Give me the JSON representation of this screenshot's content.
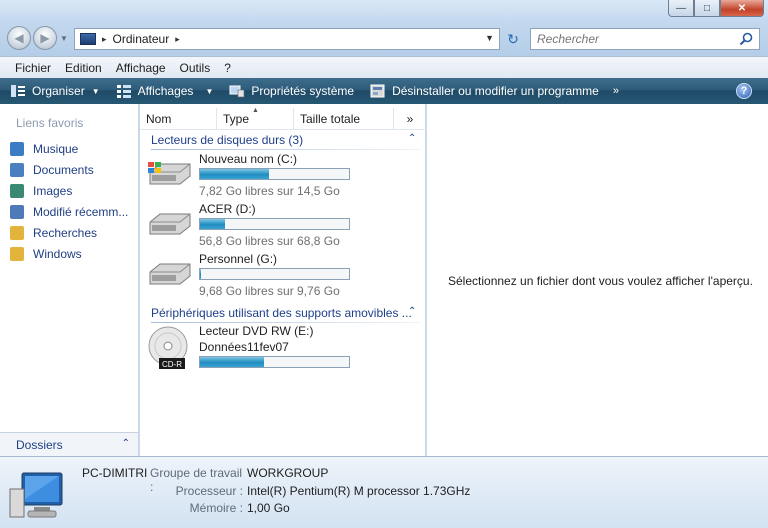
{
  "window": {
    "controls": {
      "minimize": "—",
      "maximize": "□",
      "close": "✕"
    }
  },
  "address_bar": {
    "location": "Ordinateur",
    "separator": "▸"
  },
  "search": {
    "placeholder": "Rechercher"
  },
  "menu": [
    "Fichier",
    "Edition",
    "Affichage",
    "Outils",
    "?"
  ],
  "command_bar": {
    "organize": "Organiser",
    "views": "Affichages",
    "system_properties": "Propriétés système",
    "uninstall": "Désinstaller ou modifier un programme",
    "more": "»",
    "help": "?"
  },
  "nav_pane": {
    "title": "Liens favoris",
    "items": [
      {
        "label": "Musique",
        "icon": "music-icon",
        "color": "#3c7cc5"
      },
      {
        "label": "Documents",
        "icon": "documents-icon",
        "color": "#4a7fc0"
      },
      {
        "label": "Images",
        "icon": "images-icon",
        "color": "#3a8a73"
      },
      {
        "label": "Modifié récemm...",
        "icon": "recent-icon",
        "color": "#4f7ab8"
      },
      {
        "label": "Recherches",
        "icon": "search-folder-icon",
        "color": "#e3b43c"
      },
      {
        "label": "Windows",
        "icon": "folder-icon",
        "color": "#e3b43c"
      }
    ],
    "folders_label": "Dossiers",
    "folders_chevron": "⌃"
  },
  "file_list": {
    "columns": [
      "Nom",
      "Type",
      "Taille totale"
    ],
    "more_columns": "»",
    "groups": [
      {
        "title": "Lecteurs de disques durs (3)",
        "chevron": "⌃"
      },
      {
        "title": "Périphériques utilisant des supports amovibles ...",
        "chevron": "⌃"
      }
    ],
    "drives": [
      {
        "name": "Nouveau nom (C:)",
        "free": "7,82 Go libres sur 14,5 Go",
        "used_fraction": 0.46,
        "icon": "system-drive-icon"
      },
      {
        "name": "ACER (D:)",
        "free": "56,8 Go libres sur 68,8 Go",
        "used_fraction": 0.17,
        "icon": "hard-drive-icon"
      },
      {
        "name": "Personnel (G:)",
        "free": "9,68 Go libres sur 9,76 Go",
        "used_fraction": 0.01,
        "icon": "hard-drive-icon"
      }
    ],
    "removable": [
      {
        "name": "Lecteur DVD RW (E:)",
        "label": "Données11fev07",
        "used_fraction": 0.43,
        "icon": "dvd-drive-icon",
        "badge": "CD-R"
      }
    ]
  },
  "preview": {
    "message": "Sélectionnez un fichier dont vous voulez afficher l'aperçu."
  },
  "details": {
    "computer_name": "PC-DIMITRI",
    "rows": [
      {
        "label": "Groupe de travail :",
        "value": "WORKGROUP"
      },
      {
        "label": "Processeur :",
        "value": "Intel(R) Pentium(R) M processor 1.73GHz"
      },
      {
        "label": "Mémoire :",
        "value": "1,00 Go"
      }
    ]
  }
}
